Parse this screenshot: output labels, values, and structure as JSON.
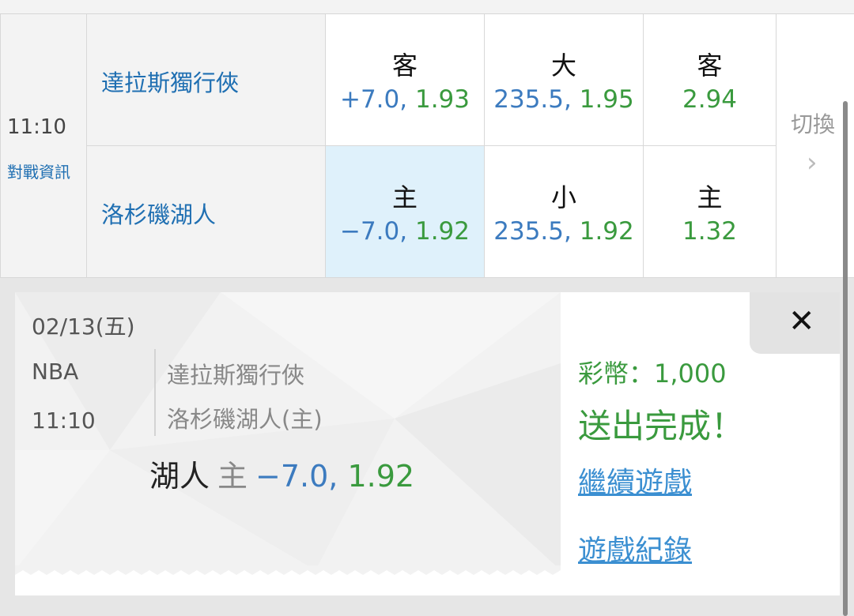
{
  "match": {
    "time": "11:10",
    "info_link": "對戰資訊",
    "away_team": "達拉斯獨行俠",
    "home_team": "洛杉磯湖人"
  },
  "odds": {
    "away_spread": {
      "label": "客",
      "value": "+7.0, 1.93"
    },
    "over": {
      "label": "大",
      "value": "235.5, 1.95"
    },
    "away_ml": {
      "label": "客",
      "value": "2.94"
    },
    "home_spread": {
      "label": "主",
      "value": "−7.0, 1.92"
    },
    "under": {
      "label": "小",
      "value": "235.5, 1.92"
    },
    "home_ml": {
      "label": "主",
      "value": "1.32"
    },
    "switch_label": "切換",
    "switch_arrow": "›"
  },
  "ticket": {
    "date": "02/13(五)",
    "league": "NBA",
    "time": "11:10",
    "away": "達拉斯獨行俠",
    "home": "洛杉磯湖人(主)",
    "pick_team": "湖人",
    "pick_side": "主",
    "pick_line": "−7.0,",
    "pick_odds": "1.92",
    "close": "✕",
    "coins": "彩幣：1,000",
    "status": "送出完成！",
    "continue_link": "繼續遊戲",
    "history_link": "遊戲紀錄"
  },
  "colors": {
    "blue": "#3c7bbf",
    "green": "#3a9a3e",
    "selected": "#dff1fb",
    "link": "#3b8fd1"
  }
}
